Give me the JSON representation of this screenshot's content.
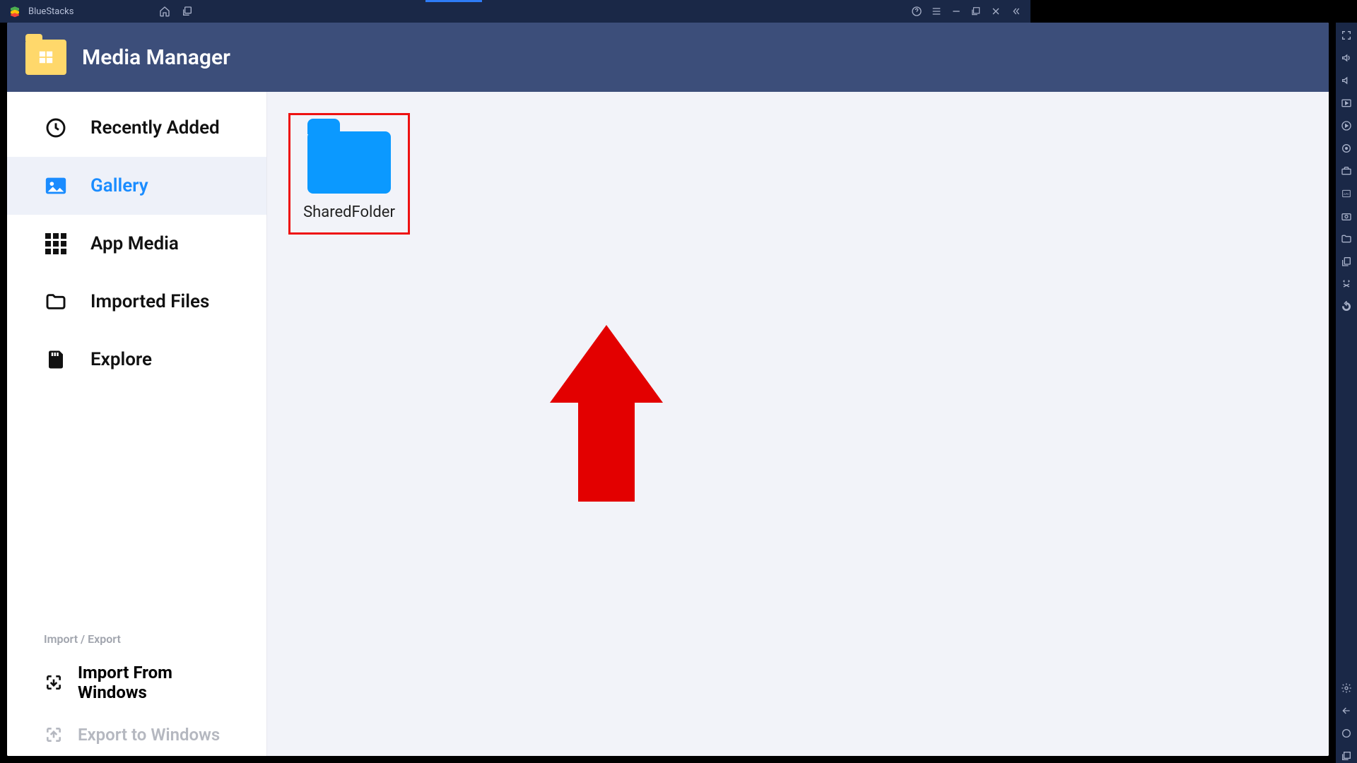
{
  "titlebar": {
    "app_name": "BlueStacks"
  },
  "header": {
    "title": "Media Manager"
  },
  "sidebar": {
    "items": [
      {
        "label": "Recently Added",
        "icon": "clock-icon",
        "active": false
      },
      {
        "label": "Gallery",
        "icon": "image-icon",
        "active": true
      },
      {
        "label": "App Media",
        "icon": "grid-icon",
        "active": false
      },
      {
        "label": "Imported Files",
        "icon": "folder-outline-icon",
        "active": false
      },
      {
        "label": "Explore",
        "icon": "sd-card-icon",
        "active": false
      }
    ],
    "section_label": "Import / Export",
    "actions": [
      {
        "label": "Import From Windows",
        "icon": "import-icon",
        "disabled": false
      },
      {
        "label": "Export to Windows",
        "icon": "export-icon",
        "disabled": true
      }
    ]
  },
  "content": {
    "folders": [
      {
        "name": "SharedFolder"
      }
    ]
  },
  "annotation": {
    "highlight_color": "#e11",
    "arrow_color": "#e30000"
  },
  "right_toolbar_icons": [
    "fullscreen-icon",
    "volume-up-icon",
    "volume-down-icon",
    "play-box-icon",
    "play-circle-icon",
    "location-icon",
    "toolbox-icon",
    "apk-icon",
    "screenshot-icon",
    "folder-icon",
    "copy-icon",
    "shake-icon",
    "rotate-icon"
  ],
  "right_toolbar_bottom": [
    "settings-icon",
    "back-icon",
    "home-icon",
    "recents-icon"
  ]
}
